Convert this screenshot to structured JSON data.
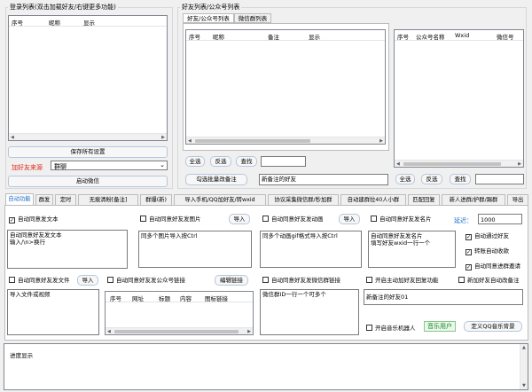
{
  "login": {
    "title": "登录列表(双击加载好友/右键更多功能)",
    "columns": [
      "序号",
      "昵称",
      "显示"
    ],
    "save_btn": "保存所有设置",
    "source_label": "加好友来源",
    "source_value": "群聊",
    "launch_btn": "启动微信"
  },
  "friends": {
    "title": "好友列表/公众号列表",
    "tabs": [
      "好友/公众号列表",
      "微信群列表"
    ],
    "columns": [
      "序号",
      "昵称",
      "备注",
      "显示"
    ],
    "select_all": "全选",
    "invert": "反选",
    "search": "查找",
    "batch_remark_btn": "勾选批量改备注",
    "remark_placeholder": "新备注的好友"
  },
  "official": {
    "columns": [
      "序号",
      "公众号名称",
      "Wxid",
      "微信号"
    ],
    "select_all": "全选",
    "invert": "反选",
    "search": "查找"
  },
  "tabs": [
    "自动功能",
    "群发",
    "定时",
    "无痕清粉[备注]",
    "群爆(新)",
    "导入手机/QQ加好友/转wxid",
    "协议采集微信群/秒加群",
    "自动建群拉40人小群",
    "匹配回复",
    "新人进群/护群/踢群",
    "导出"
  ],
  "auto": {
    "agree_text": "自动同意发文本",
    "agree_text_content": "自动同意好友发文本\n输入/\\n>换行",
    "agree_image": "自动同意好友发图片",
    "import1": "导入",
    "image_hint": "同多个图片导入按Ctrl",
    "agree_gif": "自动同意好友发动画",
    "import2": "导入",
    "gif_hint": "同多个动画gif格式导入按Ctrl",
    "agree_card": "自动同意好友发名片",
    "delay_label": "延迟：",
    "delay_value": "1000",
    "card_content": "自动同意好友发名片\n填写好友wxid一行一个",
    "auto_pass": "自动通过好友",
    "delete_collect": "转账自动收款",
    "auto_group": "自动同意进群邀请",
    "agree_file": "自动同意好友发文件",
    "import3": "导入",
    "file_hint": "导入文件或视频",
    "agree_official": "自动同意好友发公众号链接",
    "edit_link": "编辑链接",
    "off_columns": [
      "序号",
      "网址",
      "标题",
      "内容",
      "图标链接"
    ],
    "agree_group_link": "自动同意好友发微信群链接",
    "group_hint": "微信群ID一行一个可多个",
    "auto_reply": "开启主动加好友回复功能",
    "auto_remark": "新加好友自动改备注",
    "remark_hint": "新备注的好友01",
    "music_bot": "开启音乐机器人",
    "music_label": "音乐用户",
    "music_btn": "定义QQ音乐背景"
  },
  "progress": {
    "label": "进度显示"
  }
}
